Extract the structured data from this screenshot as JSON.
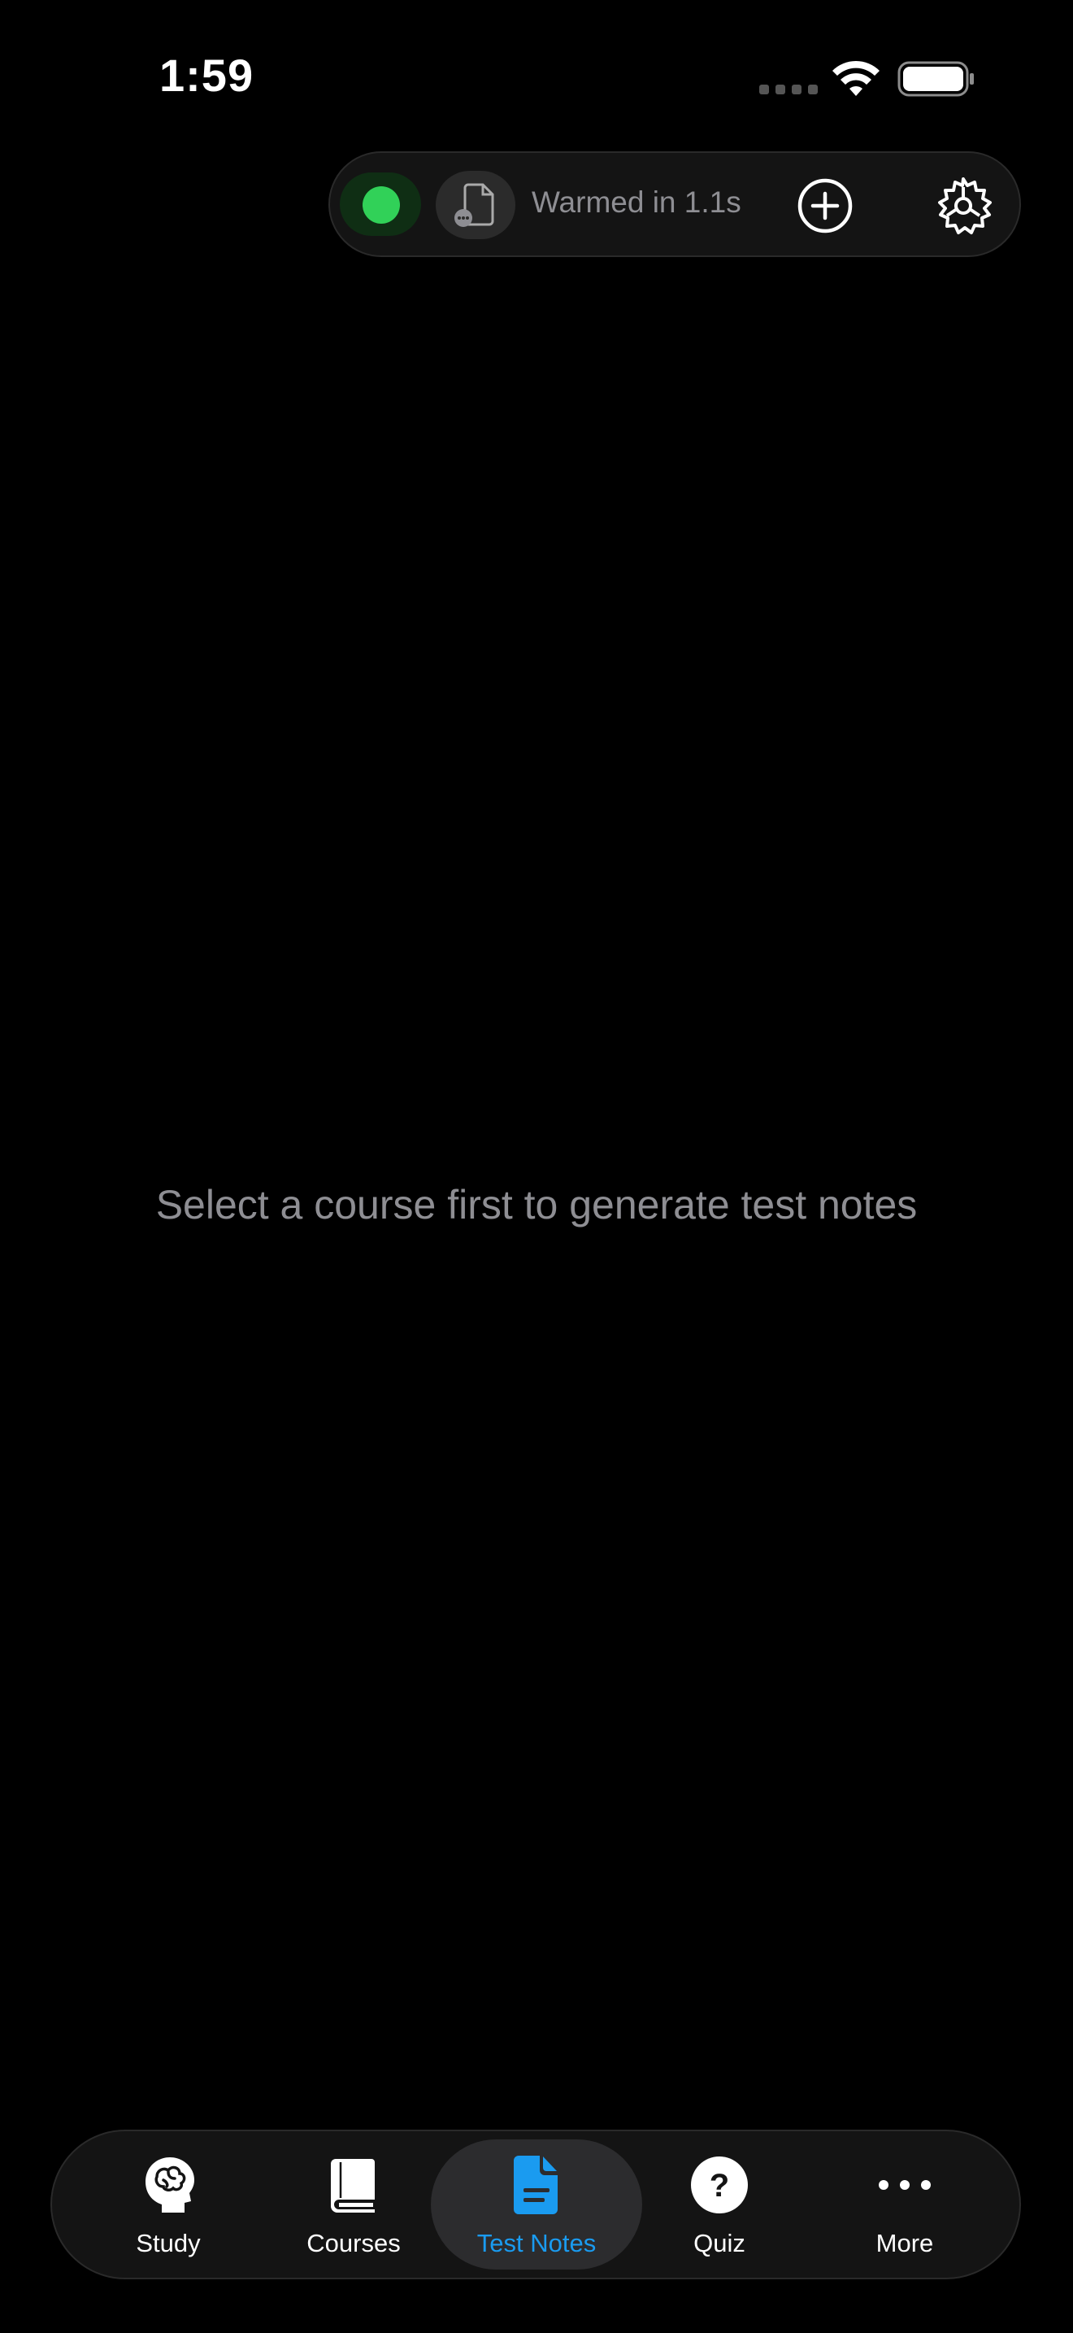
{
  "status_bar": {
    "time": "1:59"
  },
  "toolbar": {
    "status_color": "#31d158",
    "status_text": "Warmed in 1.1s",
    "add_icon": "plus-circle-icon",
    "settings_icon": "gear-icon",
    "document_icon": "document-icon"
  },
  "main": {
    "empty_message": "Select a course first to generate test notes"
  },
  "tab_bar": {
    "active_color": "#1a9bf0",
    "tabs": [
      {
        "label": "Study",
        "icon": "brain-head-icon",
        "active": false
      },
      {
        "label": "Courses",
        "icon": "book-icon",
        "active": false
      },
      {
        "label": "Test Notes",
        "icon": "document-text-icon",
        "active": true
      },
      {
        "label": "Quiz",
        "icon": "question-circle-icon",
        "active": false
      },
      {
        "label": "More",
        "icon": "ellipsis-icon",
        "active": false
      }
    ]
  }
}
